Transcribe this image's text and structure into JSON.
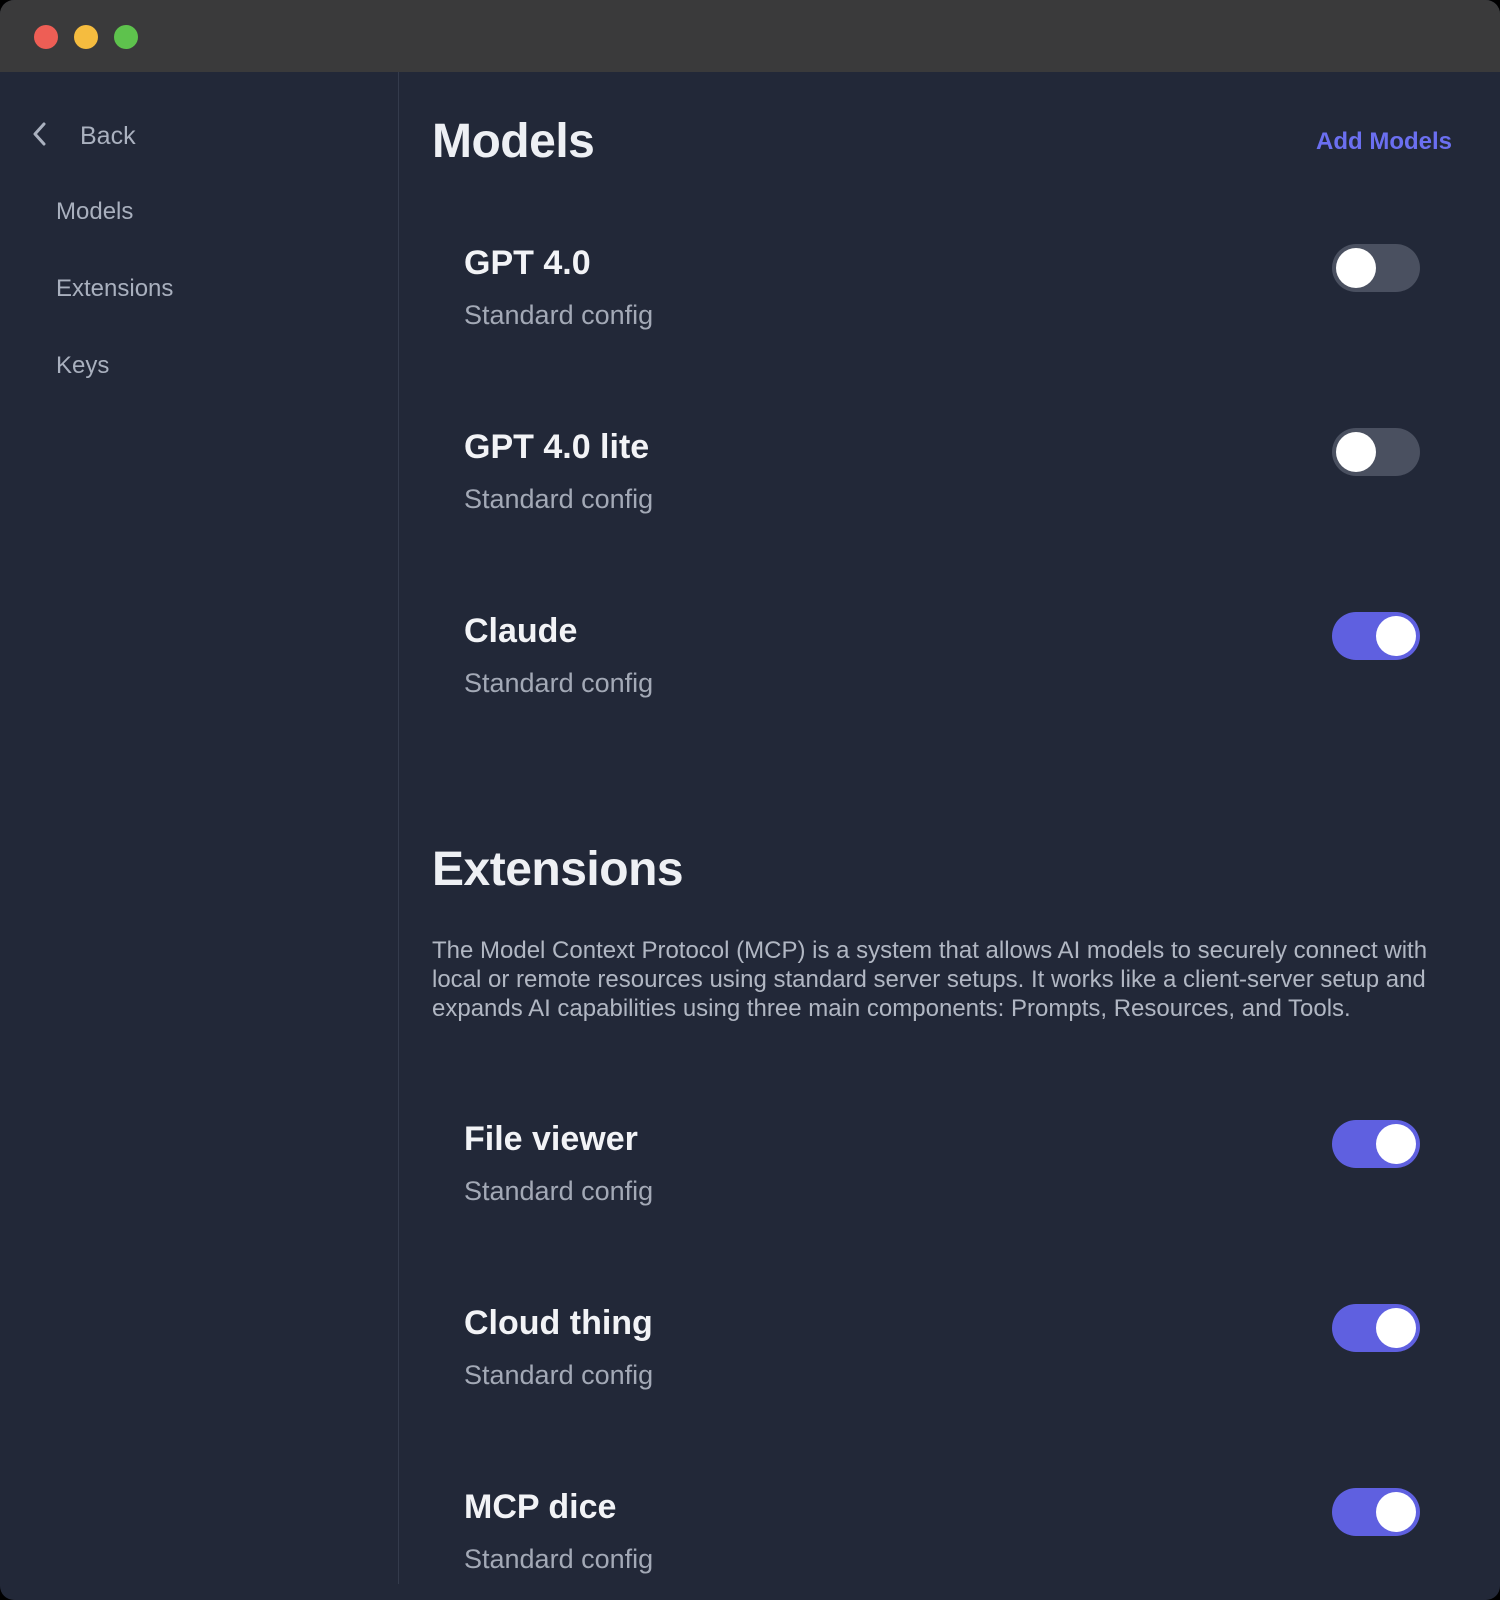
{
  "window": {
    "controls": [
      "close",
      "minimize",
      "maximize"
    ],
    "colors": {
      "close": "#ee5e55",
      "minimize": "#f5bc3f",
      "maximize": "#5ec24d"
    }
  },
  "sidebar": {
    "back_label": "Back",
    "items": [
      {
        "label": "Models"
      },
      {
        "label": "Extensions"
      },
      {
        "label": "Keys"
      }
    ]
  },
  "models": {
    "title": "Models",
    "add_label": "Add Models",
    "items": [
      {
        "name": "GPT 4.0",
        "subtitle": "Standard config",
        "enabled": false
      },
      {
        "name": "GPT 4.0 lite",
        "subtitle": "Standard config",
        "enabled": false
      },
      {
        "name": "Claude",
        "subtitle": "Standard config",
        "enabled": true
      }
    ]
  },
  "extensions": {
    "title": "Extensions",
    "description": "The Model Context Protocol (MCP) is a system that allows AI models to securely connect with local or remote resources using standard server setups. It works like a client-server setup and expands AI capabilities using three main components: Prompts, Resources, and Tools.",
    "items": [
      {
        "name": "File viewer",
        "subtitle": "Standard config",
        "enabled": true
      },
      {
        "name": "Cloud thing",
        "subtitle": "Standard config",
        "enabled": true
      },
      {
        "name": "MCP dice",
        "subtitle": "Standard config",
        "enabled": true
      }
    ]
  },
  "theme": {
    "accent": "#5f60e0",
    "link": "#6b6ff0",
    "background": "#222838",
    "toggle_off": "#4a5060"
  }
}
